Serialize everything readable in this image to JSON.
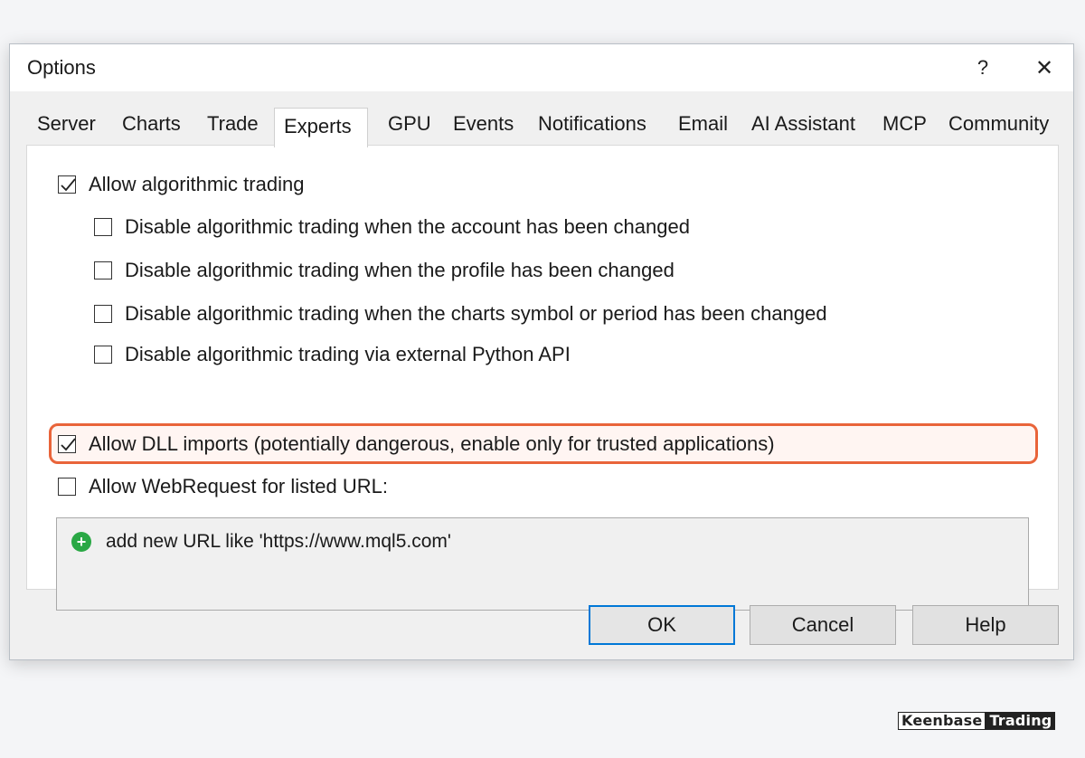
{
  "window": {
    "title": "Options",
    "help_glyph": "?",
    "close_glyph": "✕"
  },
  "tabs": [
    {
      "label": "Server"
    },
    {
      "label": "Charts"
    },
    {
      "label": "Trade"
    },
    {
      "label": "Experts",
      "active": true
    },
    {
      "label": "GPU"
    },
    {
      "label": "Events"
    },
    {
      "label": "Notifications"
    },
    {
      "label": "Email"
    },
    {
      "label": "AI Assistant"
    },
    {
      "label": "MCP"
    },
    {
      "label": "Community"
    }
  ],
  "options": [
    {
      "label": "Allow algorithmic trading",
      "checked": true
    },
    {
      "label": "Disable algorithmic trading when the account has been changed",
      "checked": false
    },
    {
      "label": "Disable algorithmic trading when the profile has been changed",
      "checked": false
    },
    {
      "label": "Disable algorithmic trading when the charts symbol or period has been changed",
      "checked": false
    },
    {
      "label": "Disable algorithmic trading via external Python API",
      "checked": false
    },
    {
      "label": "Allow DLL imports (potentially dangerous, enable only for trusted applications)",
      "checked": true,
      "highlighted": true
    },
    {
      "label": "Allow WebRequest for listed URL:",
      "checked": false
    }
  ],
  "url_list": {
    "add_label": "add new URL like 'https://www.mql5.com'",
    "add_icon": "plus-circle-icon"
  },
  "buttons": {
    "ok": "OK",
    "cancel": "Cancel",
    "help": "Help"
  },
  "watermark": {
    "part1": "Keenbase",
    "part2": "Trading"
  },
  "colors": {
    "highlight_border": "#e9643a",
    "ok_focus_border": "#0078d7",
    "add_icon": "#2aa845"
  }
}
